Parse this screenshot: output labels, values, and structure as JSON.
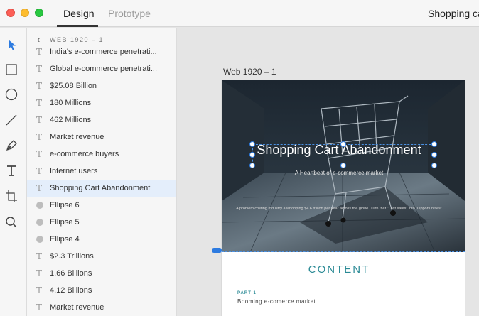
{
  "window": {
    "tabs": {
      "design": "Design",
      "prototype": "Prototype"
    },
    "document_title": "Shopping ca"
  },
  "toolbar": {
    "tools": [
      "select-arrow-icon",
      "rectangle-icon",
      "ellipse-icon",
      "line-icon",
      "pen-icon",
      "text-icon",
      "artboard-icon",
      "zoom-icon"
    ]
  },
  "layers": {
    "artboard_name": "WEB 1920 – 1",
    "items": [
      {
        "label": "India's e-commerce penetrati...",
        "type": "text"
      },
      {
        "label": "Global e-commerce penetrati...",
        "type": "text"
      },
      {
        "label": "$25.08 Billion",
        "type": "text"
      },
      {
        "label": "180 Millions",
        "type": "text"
      },
      {
        "label": "462 Millions",
        "type": "text"
      },
      {
        "label": "Market revenue",
        "type": "text"
      },
      {
        "label": "e-commerce buyers",
        "type": "text"
      },
      {
        "label": "Internet users",
        "type": "text"
      },
      {
        "label": "Shopping Cart Abandonment",
        "type": "text",
        "selected": true
      },
      {
        "label": "Ellipse 6",
        "type": "ellipse"
      },
      {
        "label": "Ellipse 5",
        "type": "ellipse"
      },
      {
        "label": "Ellipse 4",
        "type": "ellipse"
      },
      {
        "label": "$2.3 Trillions",
        "type": "text"
      },
      {
        "label": "1.66 Billions",
        "type": "text"
      },
      {
        "label": "4.12 Billions",
        "type": "text"
      },
      {
        "label": "Market revenue",
        "type": "text"
      }
    ]
  },
  "canvas": {
    "artboard_label": "Web 1920 – 1",
    "hero": {
      "title": "Shopping Cart Abandonment",
      "subtitle": "A Heartbeat of e-commerce market",
      "description": "A problem costing Industry a whooping $4.6 trillion per year across the globe. Turn that \"Lost sales\" into \"Opportunities\""
    },
    "content": {
      "heading": "CONTENT",
      "part_label": "PART 1",
      "part_title": "Booming e-comerce market"
    }
  },
  "colors": {
    "selection": "#2d7be0",
    "accent": "#2a8a95"
  }
}
